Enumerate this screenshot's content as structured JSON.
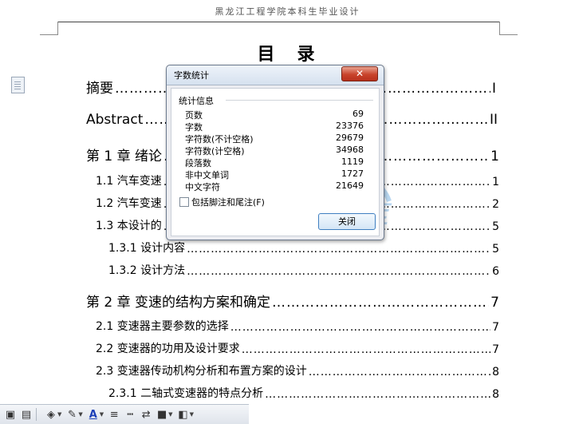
{
  "page_header": "黑龙江工程学院本科生毕业设计",
  "toc": {
    "title": "目录",
    "entries": [
      {
        "label": "摘要",
        "page": "I"
      },
      {
        "label": "Abstract",
        "page": "II"
      },
      {
        "label": "第 1 章  绪论",
        "page": "1"
      },
      {
        "label": "1.1 汽车变速",
        "page": "1"
      },
      {
        "label": "1.2  汽车变速",
        "page": "2"
      },
      {
        "label": "1.3 本设计的",
        "page": "5"
      },
      {
        "label": "1.3.1 设计内容",
        "page": "5"
      },
      {
        "label": "1.3.2 设计方法",
        "page": "6"
      },
      {
        "label": "第 2 章  变速的结构方案和确定",
        "page": "7"
      },
      {
        "label": "2.1  变速器主要参数的选择",
        "page": "7"
      },
      {
        "label": "2.2  变速器的功用及设计要求",
        "page": "7"
      },
      {
        "label": "2.3 变速器传动机构分析和布置方案的设计",
        "page": "8"
      },
      {
        "label": "2.3.1 二轴式变速器的特点分析",
        "page": "8"
      }
    ]
  },
  "dialog": {
    "title": "字数统计",
    "close_glyph": "✕",
    "group_label": "统计信息",
    "stats": [
      {
        "label": "页数",
        "value": "69"
      },
      {
        "label": "字数",
        "value": "23376"
      },
      {
        "label": "字符数(不计空格)",
        "value": "29679"
      },
      {
        "label": "字符数(计空格)",
        "value": "34968"
      },
      {
        "label": "段落数",
        "value": "1119"
      },
      {
        "label": "非中文单词",
        "value": "1727"
      },
      {
        "label": "中文字符",
        "value": "21649"
      }
    ],
    "checkbox_label": "包括脚注和尾注(F)",
    "checkbox_checked": false,
    "ok_label": "关闭"
  },
  "watermark": {
    "text": "人人文库"
  },
  "toolbar": {
    "icons": [
      "image-icon",
      "textbox-icon",
      "fill-color-icon",
      "line-color-icon",
      "font-color-icon",
      "line-style-icon",
      "dash-style-icon",
      "arrow-style-icon",
      "shadow-icon",
      "3d-icon"
    ],
    "font_color_glyph": "A"
  }
}
